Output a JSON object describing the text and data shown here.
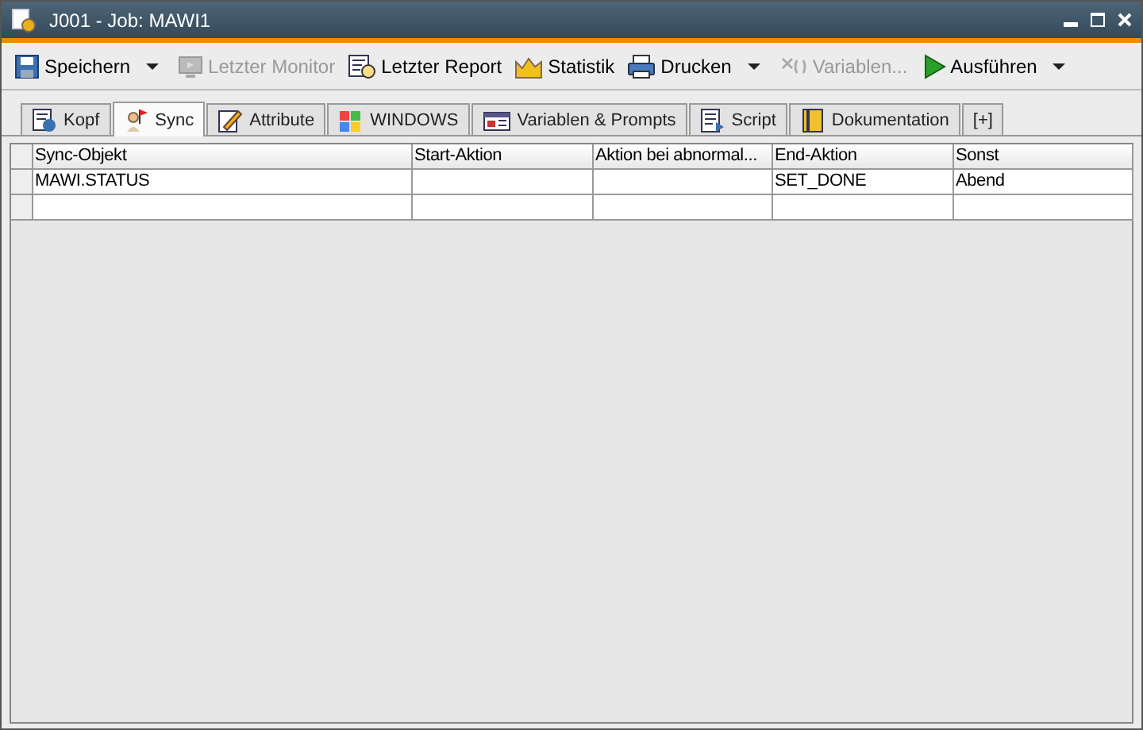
{
  "window": {
    "title": "J001 - Job: MAWI1"
  },
  "toolbar": [
    {
      "label": "Speichern",
      "disabled": false,
      "dropdown": true
    },
    {
      "label": "Letzter Monitor",
      "disabled": true,
      "dropdown": false
    },
    {
      "label": "Letzter Report",
      "disabled": false,
      "dropdown": false
    },
    {
      "label": "Statistik",
      "disabled": false,
      "dropdown": false
    },
    {
      "label": "Drucken",
      "disabled": false,
      "dropdown": true
    },
    {
      "label": "Variablen...",
      "disabled": true,
      "dropdown": false
    },
    {
      "label": "Ausführen",
      "disabled": false,
      "dropdown": true
    }
  ],
  "tabs": [
    {
      "label": "Kopf",
      "selected": false
    },
    {
      "label": "Sync",
      "selected": true
    },
    {
      "label": "Attribute",
      "selected": false
    },
    {
      "label": "WINDOWS",
      "selected": false
    },
    {
      "label": "Variablen & Prompts",
      "selected": false
    },
    {
      "label": "Script",
      "selected": false
    },
    {
      "label": "Dokumentation",
      "selected": false
    },
    {
      "label": "[+]",
      "selected": false
    }
  ],
  "table": {
    "columns": [
      "Sync-Objekt",
      "Start-Aktion",
      "Aktion bei abnormal...",
      "End-Aktion",
      "Sonst"
    ],
    "rows": [
      [
        "MAWI.STATUS",
        "",
        "",
        "SET_DONE",
        "Abend"
      ],
      [
        "",
        "",
        "",
        "",
        ""
      ]
    ]
  }
}
